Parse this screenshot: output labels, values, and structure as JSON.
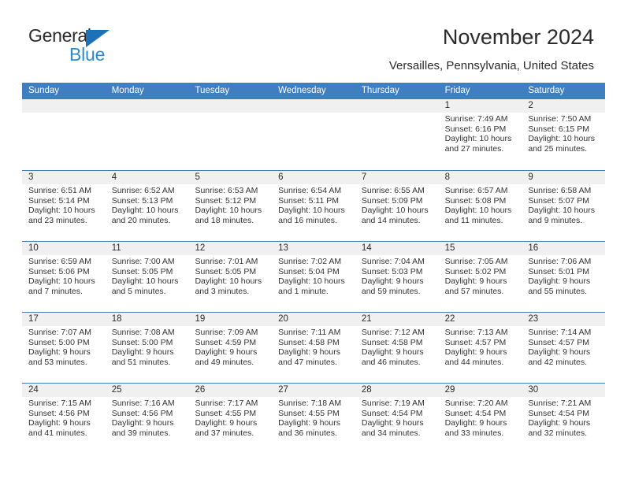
{
  "logo": {
    "text_primary": "General",
    "text_secondary": "Blue",
    "icon": "triangle-flag-icon",
    "color_primary": "#2b2b2b",
    "color_secondary": "#2b8ad6",
    "triangle_color": "#1d71b8"
  },
  "header": {
    "title": "November 2024",
    "subtitle": "Versailles, Pennsylvania, United States"
  },
  "theme": {
    "header_blue": "#3f7fc1",
    "datestrip_gray": "#f0f0f0",
    "text": "#2b2b2b"
  },
  "weekday_headers": [
    "Sunday",
    "Monday",
    "Tuesday",
    "Wednesday",
    "Thursday",
    "Friday",
    "Saturday"
  ],
  "labels": {
    "sunrise_prefix": "Sunrise:",
    "sunset_prefix": "Sunset:",
    "daylight_prefix": "Daylight:"
  },
  "weeks": [
    [
      {
        "day": "",
        "sunrise": "",
        "sunset": "",
        "daylight": ""
      },
      {
        "day": "",
        "sunrise": "",
        "sunset": "",
        "daylight": ""
      },
      {
        "day": "",
        "sunrise": "",
        "sunset": "",
        "daylight": ""
      },
      {
        "day": "",
        "sunrise": "",
        "sunset": "",
        "daylight": ""
      },
      {
        "day": "",
        "sunrise": "",
        "sunset": "",
        "daylight": ""
      },
      {
        "day": "1",
        "sunrise": "Sunrise: 7:49 AM",
        "sunset": "Sunset: 6:16 PM",
        "daylight": "Daylight: 10 hours and 27 minutes."
      },
      {
        "day": "2",
        "sunrise": "Sunrise: 7:50 AM",
        "sunset": "Sunset: 6:15 PM",
        "daylight": "Daylight: 10 hours and 25 minutes."
      }
    ],
    [
      {
        "day": "3",
        "sunrise": "Sunrise: 6:51 AM",
        "sunset": "Sunset: 5:14 PM",
        "daylight": "Daylight: 10 hours and 23 minutes."
      },
      {
        "day": "4",
        "sunrise": "Sunrise: 6:52 AM",
        "sunset": "Sunset: 5:13 PM",
        "daylight": "Daylight: 10 hours and 20 minutes."
      },
      {
        "day": "5",
        "sunrise": "Sunrise: 6:53 AM",
        "sunset": "Sunset: 5:12 PM",
        "daylight": "Daylight: 10 hours and 18 minutes."
      },
      {
        "day": "6",
        "sunrise": "Sunrise: 6:54 AM",
        "sunset": "Sunset: 5:11 PM",
        "daylight": "Daylight: 10 hours and 16 minutes."
      },
      {
        "day": "7",
        "sunrise": "Sunrise: 6:55 AM",
        "sunset": "Sunset: 5:09 PM",
        "daylight": "Daylight: 10 hours and 14 minutes."
      },
      {
        "day": "8",
        "sunrise": "Sunrise: 6:57 AM",
        "sunset": "Sunset: 5:08 PM",
        "daylight": "Daylight: 10 hours and 11 minutes."
      },
      {
        "day": "9",
        "sunrise": "Sunrise: 6:58 AM",
        "sunset": "Sunset: 5:07 PM",
        "daylight": "Daylight: 10 hours and 9 minutes."
      }
    ],
    [
      {
        "day": "10",
        "sunrise": "Sunrise: 6:59 AM",
        "sunset": "Sunset: 5:06 PM",
        "daylight": "Daylight: 10 hours and 7 minutes."
      },
      {
        "day": "11",
        "sunrise": "Sunrise: 7:00 AM",
        "sunset": "Sunset: 5:05 PM",
        "daylight": "Daylight: 10 hours and 5 minutes."
      },
      {
        "day": "12",
        "sunrise": "Sunrise: 7:01 AM",
        "sunset": "Sunset: 5:05 PM",
        "daylight": "Daylight: 10 hours and 3 minutes."
      },
      {
        "day": "13",
        "sunrise": "Sunrise: 7:02 AM",
        "sunset": "Sunset: 5:04 PM",
        "daylight": "Daylight: 10 hours and 1 minute."
      },
      {
        "day": "14",
        "sunrise": "Sunrise: 7:04 AM",
        "sunset": "Sunset: 5:03 PM",
        "daylight": "Daylight: 9 hours and 59 minutes."
      },
      {
        "day": "15",
        "sunrise": "Sunrise: 7:05 AM",
        "sunset": "Sunset: 5:02 PM",
        "daylight": "Daylight: 9 hours and 57 minutes."
      },
      {
        "day": "16",
        "sunrise": "Sunrise: 7:06 AM",
        "sunset": "Sunset: 5:01 PM",
        "daylight": "Daylight: 9 hours and 55 minutes."
      }
    ],
    [
      {
        "day": "17",
        "sunrise": "Sunrise: 7:07 AM",
        "sunset": "Sunset: 5:00 PM",
        "daylight": "Daylight: 9 hours and 53 minutes."
      },
      {
        "day": "18",
        "sunrise": "Sunrise: 7:08 AM",
        "sunset": "Sunset: 5:00 PM",
        "daylight": "Daylight: 9 hours and 51 minutes."
      },
      {
        "day": "19",
        "sunrise": "Sunrise: 7:09 AM",
        "sunset": "Sunset: 4:59 PM",
        "daylight": "Daylight: 9 hours and 49 minutes."
      },
      {
        "day": "20",
        "sunrise": "Sunrise: 7:11 AM",
        "sunset": "Sunset: 4:58 PM",
        "daylight": "Daylight: 9 hours and 47 minutes."
      },
      {
        "day": "21",
        "sunrise": "Sunrise: 7:12 AM",
        "sunset": "Sunset: 4:58 PM",
        "daylight": "Daylight: 9 hours and 46 minutes."
      },
      {
        "day": "22",
        "sunrise": "Sunrise: 7:13 AM",
        "sunset": "Sunset: 4:57 PM",
        "daylight": "Daylight: 9 hours and 44 minutes."
      },
      {
        "day": "23",
        "sunrise": "Sunrise: 7:14 AM",
        "sunset": "Sunset: 4:57 PM",
        "daylight": "Daylight: 9 hours and 42 minutes."
      }
    ],
    [
      {
        "day": "24",
        "sunrise": "Sunrise: 7:15 AM",
        "sunset": "Sunset: 4:56 PM",
        "daylight": "Daylight: 9 hours and 41 minutes."
      },
      {
        "day": "25",
        "sunrise": "Sunrise: 7:16 AM",
        "sunset": "Sunset: 4:56 PM",
        "daylight": "Daylight: 9 hours and 39 minutes."
      },
      {
        "day": "26",
        "sunrise": "Sunrise: 7:17 AM",
        "sunset": "Sunset: 4:55 PM",
        "daylight": "Daylight: 9 hours and 37 minutes."
      },
      {
        "day": "27",
        "sunrise": "Sunrise: 7:18 AM",
        "sunset": "Sunset: 4:55 PM",
        "daylight": "Daylight: 9 hours and 36 minutes."
      },
      {
        "day": "28",
        "sunrise": "Sunrise: 7:19 AM",
        "sunset": "Sunset: 4:54 PM",
        "daylight": "Daylight: 9 hours and 34 minutes."
      },
      {
        "day": "29",
        "sunrise": "Sunrise: 7:20 AM",
        "sunset": "Sunset: 4:54 PM",
        "daylight": "Daylight: 9 hours and 33 minutes."
      },
      {
        "day": "30",
        "sunrise": "Sunrise: 7:21 AM",
        "sunset": "Sunset: 4:54 PM",
        "daylight": "Daylight: 9 hours and 32 minutes."
      }
    ]
  ]
}
